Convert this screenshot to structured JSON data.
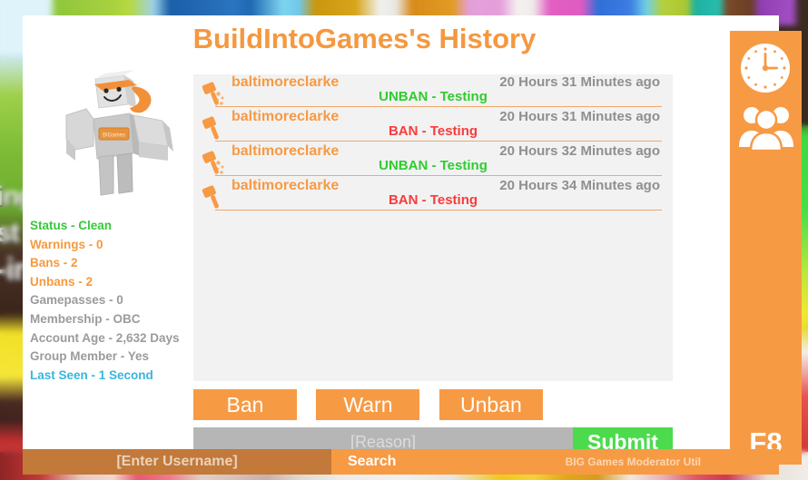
{
  "window": {
    "title": "BuildIntoGames's History"
  },
  "avatar": {
    "name_tag": "BIGames",
    "alt": "roblox-avatar"
  },
  "stats": {
    "items": [
      {
        "label": "Status - Clean",
        "color_class": "st-green"
      },
      {
        "label": "Warnings - 0",
        "color_class": "st-orange"
      },
      {
        "label": "Bans - 2",
        "color_class": "st-orange"
      },
      {
        "label": "Unbans - 2",
        "color_class": "st-orange"
      },
      {
        "label": "Gamepasses - 0",
        "color_class": "st-gray"
      },
      {
        "label": "Membership - OBC",
        "color_class": "st-gray"
      },
      {
        "label": "Account Age - 2,632 Days",
        "color_class": "st-gray"
      },
      {
        "label": "Group Member - Yes",
        "color_class": "st-gray"
      },
      {
        "label": "Last Seen - 1 Second",
        "color_class": "st-blue"
      }
    ]
  },
  "history": {
    "entries": [
      {
        "user": "baltimoreclarke",
        "time": "20 Hours 31 Minutes ago",
        "action": "UNBAN - Testing",
        "action_type": "unban",
        "icon": "gavel-unban-icon"
      },
      {
        "user": "baltimoreclarke",
        "time": "20 Hours 31 Minutes ago",
        "action": "BAN - Testing",
        "action_type": "ban",
        "icon": "gavel-ban-icon"
      },
      {
        "user": "baltimoreclarke",
        "time": "20 Hours 32 Minutes ago",
        "action": "UNBAN - Testing",
        "action_type": "unban",
        "icon": "gavel-unban-icon"
      },
      {
        "user": "baltimoreclarke",
        "time": "20 Hours 34 Minutes ago",
        "action": "BAN - Testing",
        "action_type": "ban",
        "icon": "gavel-ban-icon"
      }
    ]
  },
  "actions": {
    "ban_label": "Ban",
    "warn_label": "Warn",
    "unban_label": "Unban"
  },
  "reason": {
    "value": "",
    "placeholder": "[Reason]",
    "submit_label": "Submit"
  },
  "sidebar": {
    "clock_icon": "clock-icon",
    "group_icon": "group-icon",
    "hotkey_label": "F8"
  },
  "bottombar": {
    "username_value": "",
    "username_placeholder": "[Enter Username]",
    "search_label": "Search",
    "brand_label": "BIG Games Moderator Util"
  },
  "background": {
    "text_1": "ing",
    "text_2": "st",
    "text_3": "-ir"
  },
  "colors": {
    "orange": "#f79a44",
    "green": "#4cdb4c",
    "red": "#fb3b3b",
    "status_green": "#35c93b",
    "blue": "#36b6dc",
    "gray_text": "#9b9b9b",
    "panel_gray": "#f2f2f2",
    "username_bg": "#c2793a"
  }
}
